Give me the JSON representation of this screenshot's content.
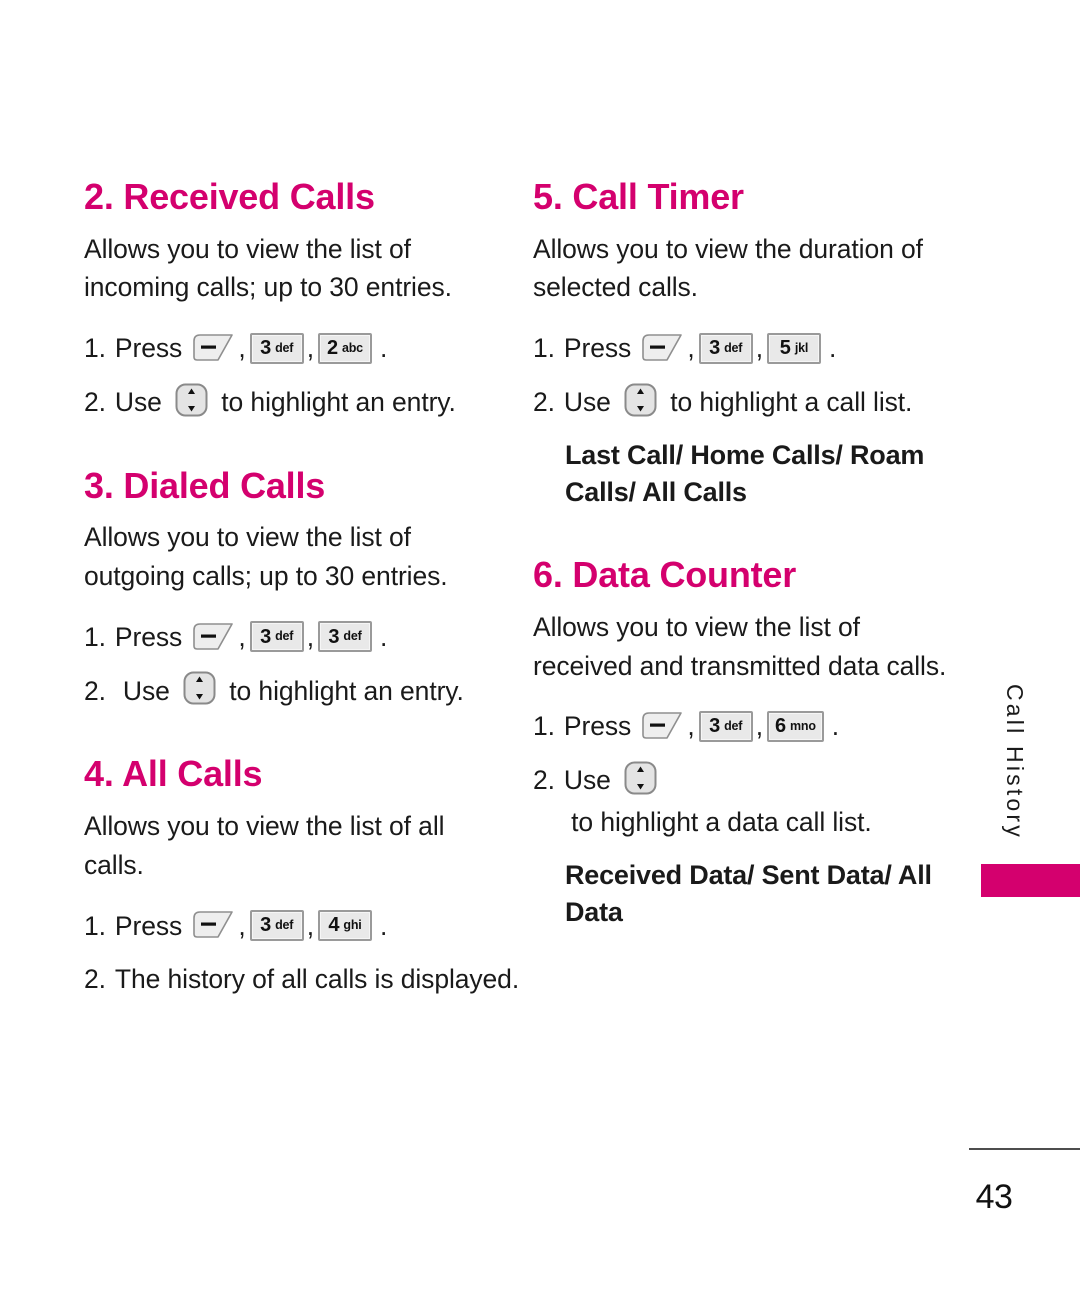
{
  "page": {
    "number": "43",
    "side_tab_label": "Call History",
    "accent_color": "#d4006e",
    "text_color": "#1a1a1a"
  },
  "icons": {
    "softkey": "menu-softkey-icon",
    "navkey": "navigation-up-down-key-icon"
  },
  "left_column": [
    {
      "title": "2. Received Calls",
      "description": "Allows you to view the list of incoming calls; up to 30 entries.",
      "steps": [
        {
          "num": "1.",
          "parts": [
            {
              "type": "text",
              "value": "Press "
            },
            {
              "type": "softkey"
            },
            {
              "type": "text",
              "value": ","
            },
            {
              "type": "key",
              "digit": "3",
              "letters": "def"
            },
            {
              "type": "text",
              "value": ","
            },
            {
              "type": "key",
              "digit": "2",
              "letters": "abc"
            },
            {
              "type": "text",
              "value": "."
            }
          ]
        },
        {
          "num": "2.",
          "parts": [
            {
              "type": "text",
              "value": "Use "
            },
            {
              "type": "navkey"
            },
            {
              "type": "text",
              "value": " to highlight an entry."
            }
          ]
        }
      ]
    },
    {
      "title": "3. Dialed Calls",
      "description": "Allows you to view the list of outgoing calls; up to 30 entries.",
      "steps": [
        {
          "num": "1.",
          "parts": [
            {
              "type": "text",
              "value": "Press "
            },
            {
              "type": "softkey"
            },
            {
              "type": "text",
              "value": ","
            },
            {
              "type": "key",
              "digit": "3",
              "letters": "def"
            },
            {
              "type": "text",
              "value": ","
            },
            {
              "type": "key",
              "digit": "3",
              "letters": "def"
            },
            {
              "type": "text",
              "value": "."
            }
          ]
        },
        {
          "num": "2.",
          "wide": true,
          "parts": [
            {
              "type": "text",
              "value": "Use "
            },
            {
              "type": "navkey"
            },
            {
              "type": "text",
              "value": " to highlight an entry."
            }
          ]
        }
      ]
    },
    {
      "title": "4. All Calls",
      "description": "Allows you to view the list of all calls.",
      "steps": [
        {
          "num": "1.",
          "parts": [
            {
              "type": "text",
              "value": "Press "
            },
            {
              "type": "softkey"
            },
            {
              "type": "text",
              "value": ","
            },
            {
              "type": "key",
              "digit": "3",
              "letters": "def"
            },
            {
              "type": "text",
              "value": ","
            },
            {
              "type": "key",
              "digit": "4",
              "letters": "ghi"
            },
            {
              "type": "text",
              "value": "."
            }
          ]
        },
        {
          "num": "2.",
          "parts": [
            {
              "type": "text",
              "value": "The history of all calls is displayed."
            }
          ]
        }
      ]
    }
  ],
  "right_column": [
    {
      "title": "5. Call Timer",
      "description": "Allows you to view the duration of selected calls.",
      "steps": [
        {
          "num": "1.",
          "parts": [
            {
              "type": "text",
              "value": "Press "
            },
            {
              "type": "softkey"
            },
            {
              "type": "text",
              "value": ","
            },
            {
              "type": "key",
              "digit": "3",
              "letters": "def"
            },
            {
              "type": "text",
              "value": ","
            },
            {
              "type": "key",
              "digit": "5",
              "letters": "jkl"
            },
            {
              "type": "text",
              "value": "."
            }
          ]
        },
        {
          "num": "2.",
          "parts": [
            {
              "type": "text",
              "value": "Use "
            },
            {
              "type": "navkey"
            },
            {
              "type": "text",
              "value": " to highlight a call list."
            }
          ]
        }
      ],
      "sub_bold": "Last Call/ Home Calls/ Roam Calls/ All Calls"
    },
    {
      "title": "6. Data Counter",
      "description": "Allows you to view the list of received and transmitted data calls.",
      "steps": [
        {
          "num": "1.",
          "parts": [
            {
              "type": "text",
              "value": "Press "
            },
            {
              "type": "softkey"
            },
            {
              "type": "text",
              "value": ","
            },
            {
              "type": "key",
              "digit": "3",
              "letters": "def"
            },
            {
              "type": "text",
              "value": ","
            },
            {
              "type": "key",
              "digit": "6",
              "letters": "mno"
            },
            {
              "type": "text",
              "value": "."
            }
          ]
        },
        {
          "num": "2.",
          "parts": [
            {
              "type": "text",
              "value": "Use "
            },
            {
              "type": "navkey"
            },
            {
              "type": "text",
              "value": " to highlight a data call list."
            }
          ]
        }
      ],
      "sub_bold": "Received Data/ Sent Data/ All Data"
    }
  ]
}
